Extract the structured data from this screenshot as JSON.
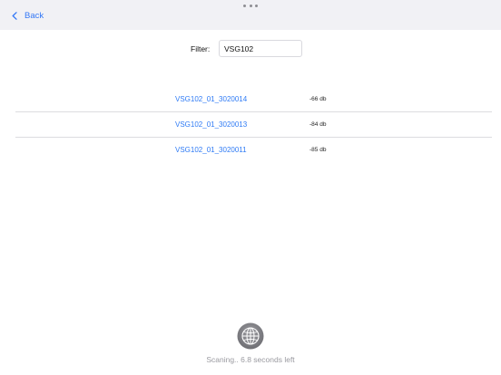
{
  "navbar": {
    "back_label": "Back"
  },
  "filter": {
    "label": "Filter:",
    "value": "VSG102"
  },
  "devices": [
    {
      "name": "VSG102_01_3020014",
      "signal": "-66 db"
    },
    {
      "name": "VSG102_01_3020013",
      "signal": "-84 db"
    },
    {
      "name": "VSG102_01_3020011",
      "signal": "-85 db"
    }
  ],
  "status": {
    "text": "Scaning.. 6.8 seconds left"
  },
  "icons": {
    "back": "chevron-left-icon",
    "scan": "globe-scan-icon",
    "handle": "more-dots-icon"
  },
  "colors": {
    "accent": "#3478f6",
    "link": "#2f7bf5",
    "navbar_bg": "#f1f1f5",
    "status_text": "#9a9aa0"
  }
}
